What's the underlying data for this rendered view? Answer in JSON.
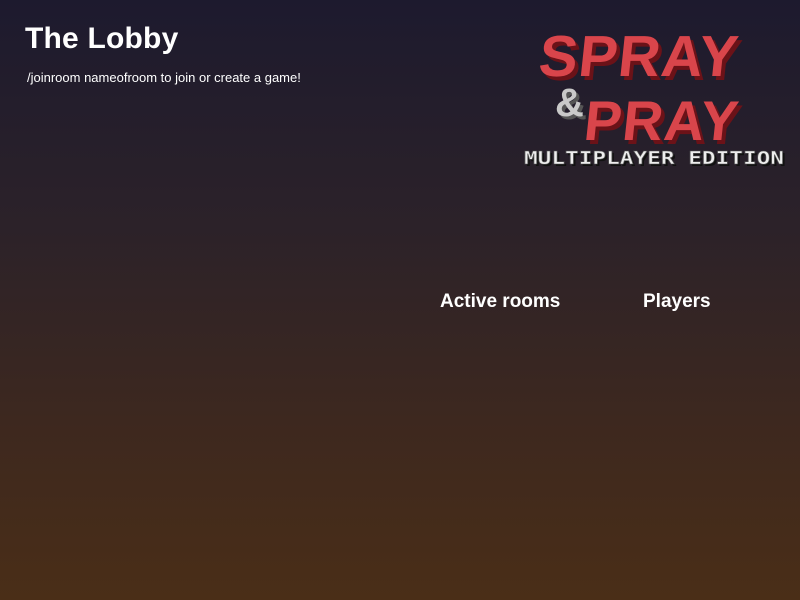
{
  "lobby": {
    "title": "The Lobby",
    "hint": "/joinroom nameofroom to join or create a game!"
  },
  "logo": {
    "line1": "SPRAY",
    "ampersand": "&",
    "line2": "PRAY",
    "subtitle": "MULTIPLAYER EDITION",
    "color_main": "#d9454b",
    "color_shadow": "#6b1218",
    "color_amp": "#c9c9c9"
  },
  "columns": {
    "active_rooms_label": "Active rooms",
    "players_label": "Players"
  },
  "active_rooms": [],
  "players": []
}
